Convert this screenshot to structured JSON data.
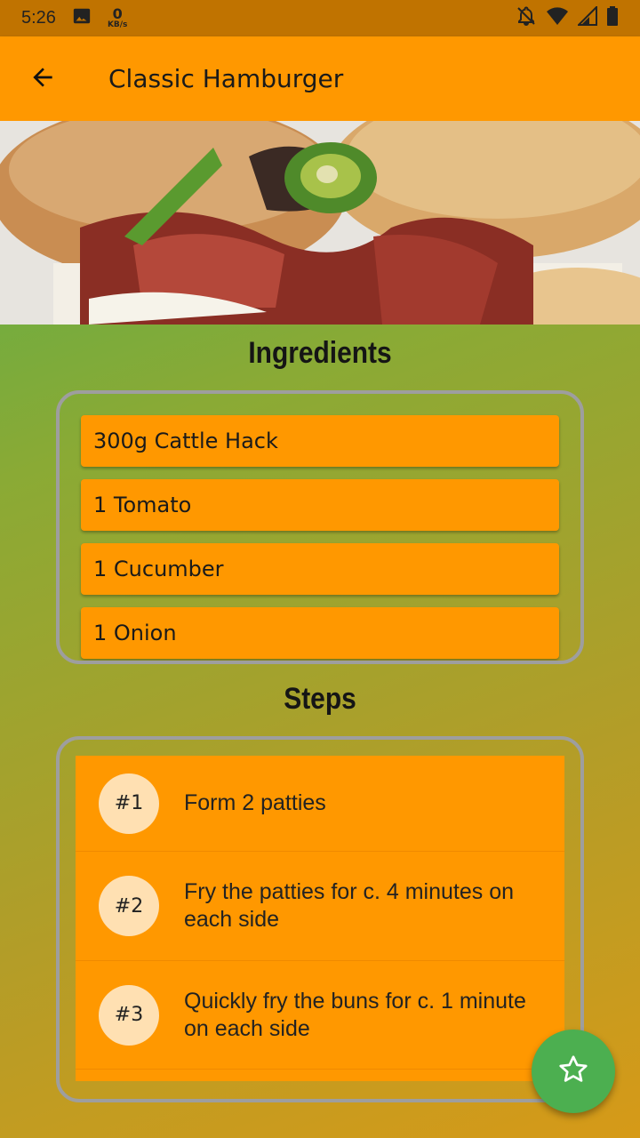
{
  "status_bar": {
    "time": "5:26",
    "net_speed_value": "0",
    "net_speed_unit": "KB/s",
    "icons": [
      "image-icon",
      "notifications-off-icon",
      "wifi-icon",
      "signal-icon",
      "battery-icon"
    ]
  },
  "app_bar": {
    "title": "Classic Hamburger",
    "back_icon": "arrow-back-icon"
  },
  "ingredients": {
    "title": "Ingredients",
    "items": [
      "300g Cattle Hack",
      "1 Tomato",
      "1 Cucumber",
      "1 Onion"
    ]
  },
  "steps": {
    "title": "Steps",
    "items": [
      {
        "badge": "#1",
        "text": "Form 2 patties"
      },
      {
        "badge": "#2",
        "text": "Fry the patties for c. 4 minutes on each side"
      },
      {
        "badge": "#3",
        "text": "Quickly fry the buns for c. 1 minute on each side"
      }
    ]
  },
  "fab": {
    "icon": "star-outline-icon"
  },
  "colors": {
    "app_bar": "#ff9800",
    "status_bar": "#c07300",
    "fab": "#4caf50",
    "badge": "#ffe0b2"
  }
}
